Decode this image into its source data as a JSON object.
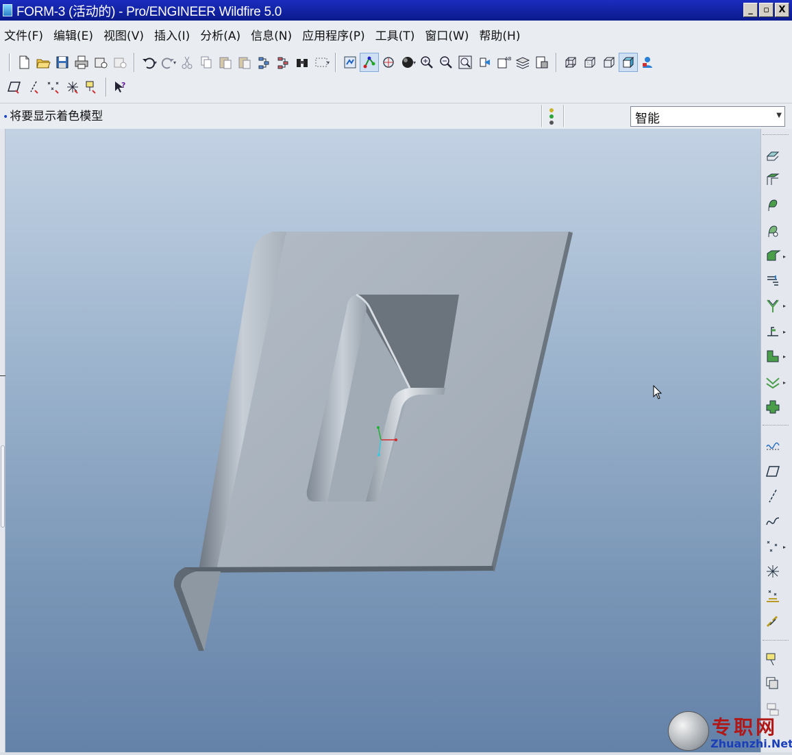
{
  "window": {
    "title": "FORM-3 (活动的) - Pro/ENGINEER Wildfire 5.0",
    "buttons": {
      "minimize": "_",
      "maximize": "▫",
      "close": "X"
    }
  },
  "menu": {
    "items": [
      "文件(F)",
      "编辑(E)",
      "视图(V)",
      "插入(I)",
      "分析(A)",
      "信息(N)",
      "应用程序(P)",
      "工具(T)",
      "窗口(W)",
      "帮助(H)"
    ]
  },
  "message": {
    "text": "将要显示着色模型"
  },
  "filter": {
    "selected": "智能"
  },
  "watermark": {
    "cn": "专职网",
    "en": "Zhuanzhi.Net"
  },
  "colors": {
    "title_bar": "#0a1a8c",
    "viewport_top": "#c3d2e3",
    "viewport_bottom": "#6481a8",
    "part_face": "#a8b1bb",
    "part_edge": "#6b757f"
  }
}
